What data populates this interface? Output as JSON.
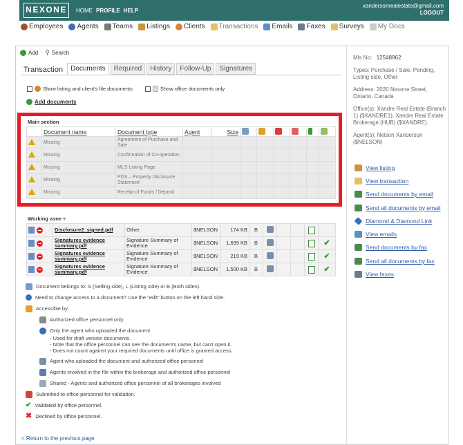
{
  "header": {
    "logo": "NEXONE",
    "nav": [
      "HOME",
      "PROFILE",
      "HELP"
    ],
    "email": "xandersonrealestate@gmail.com",
    "logout": "LOGOUT"
  },
  "main_nav": [
    "Employees",
    "Agents",
    "Teams",
    "Listings",
    "Clients",
    "Transactions",
    "Emails",
    "Faxes",
    "Surveys",
    "My Docs"
  ],
  "toolbar": {
    "add": "Add",
    "search": "Search"
  },
  "tabs": [
    "Transaction",
    "Documents",
    "Required",
    "History",
    "Follow-Up",
    "Signatures"
  ],
  "filters": {
    "listing_client": "Show listing and client's file documents",
    "office_only": "Show office documents only"
  },
  "add_documents": "Add documents",
  "main_section": {
    "title": "Main section",
    "headers": [
      "Document name",
      "Document type",
      "Agent",
      "Size"
    ],
    "rows": [
      {
        "name": "Missing",
        "type": "Agreement of Purchase and Sale"
      },
      {
        "name": "Missing",
        "type": "Confirmation of Co-operation"
      },
      {
        "name": "Missing",
        "type": "MLS Listing Page"
      },
      {
        "name": "Missing",
        "type": "PDS – Property Disclosure Statement"
      },
      {
        "name": "Missing",
        "type": "Receipt of Funds / Deposit"
      }
    ]
  },
  "working_zone": {
    "title": "Working zone",
    "rows": [
      {
        "name": "Disclosure2_signed.pdf",
        "type": "Other",
        "agent": "$NELSON",
        "size": "174 KB",
        "side": "B",
        "validated": false
      },
      {
        "name": "Signatures evidence summary.pdf",
        "type": "Signature Summary of Evidence",
        "agent": "$NELSON",
        "size": "1,699 KB",
        "side": "B",
        "validated": true
      },
      {
        "name": "Signatures evidence summary.pdf",
        "type": "Signature Summary of Evidence",
        "agent": "$NELSON",
        "size": "219 KB",
        "side": "B",
        "validated": true
      },
      {
        "name": "Signatures evidence summary.pdf",
        "type": "Signature Summary of Evidence",
        "agent": "$NELSON",
        "size": "1,500 KB",
        "side": "B",
        "validated": true
      }
    ]
  },
  "legend": {
    "belongs": "Document belongs to: S (Selling side), L (Listing side) or B (Both sides).",
    "access_change": "Need to change access to a document? Use the \"edit\" button on the left hand side.",
    "accessible_by": "Accessible by:",
    "authorized_only": "Authorized office personnel only",
    "only_agent": "Only the agent who uploaded the document",
    "only_agent_notes": [
      "- Used for draft version documents.",
      "- Note that the office personnel can see the document's name, but can't open it.",
      "- Does not count against your required documents until office is granted access."
    ],
    "agent_and_office": "Agent who uploaded the document and authorized office personnel",
    "agents_brokerage": "Agents involved in the file within the brokerage and authorized office personnel",
    "shared": "Shared - Agents and authorized office personnel of all brokerages involved",
    "submitted": "Submitted to office personnel for validation.",
    "validated": "Validated by office personnel.",
    "declined": "Declined by office personnel."
  },
  "back_link": "< Return to the previous page",
  "info": {
    "mls_label": "Mls No:",
    "mls_value": "12548962",
    "types": "Types: Purchase / Sale, Pending, Listing side, Other",
    "address": "Address: 2020 Nexone Street, Ontario, Canada",
    "offices": "Office(s): Xandre Real Estate (Branch 1) ($XANDRE1), Xandre Real Estate Brokerage (HUB) ($XANDRE)",
    "agents": "Agent(s): Nelson Xanderson ($NELSON)"
  },
  "right_links": [
    "View listing",
    "View transaction",
    "Send documents by email",
    "Send all documents by email",
    "Diamond & Diamond Link",
    "View emails",
    "Send documents by fax",
    "Send all documents by fax",
    "View faxes"
  ],
  "colors": {
    "header": "#2e6f6b",
    "highlight": "#e31e24",
    "link": "#2f5aa8"
  }
}
